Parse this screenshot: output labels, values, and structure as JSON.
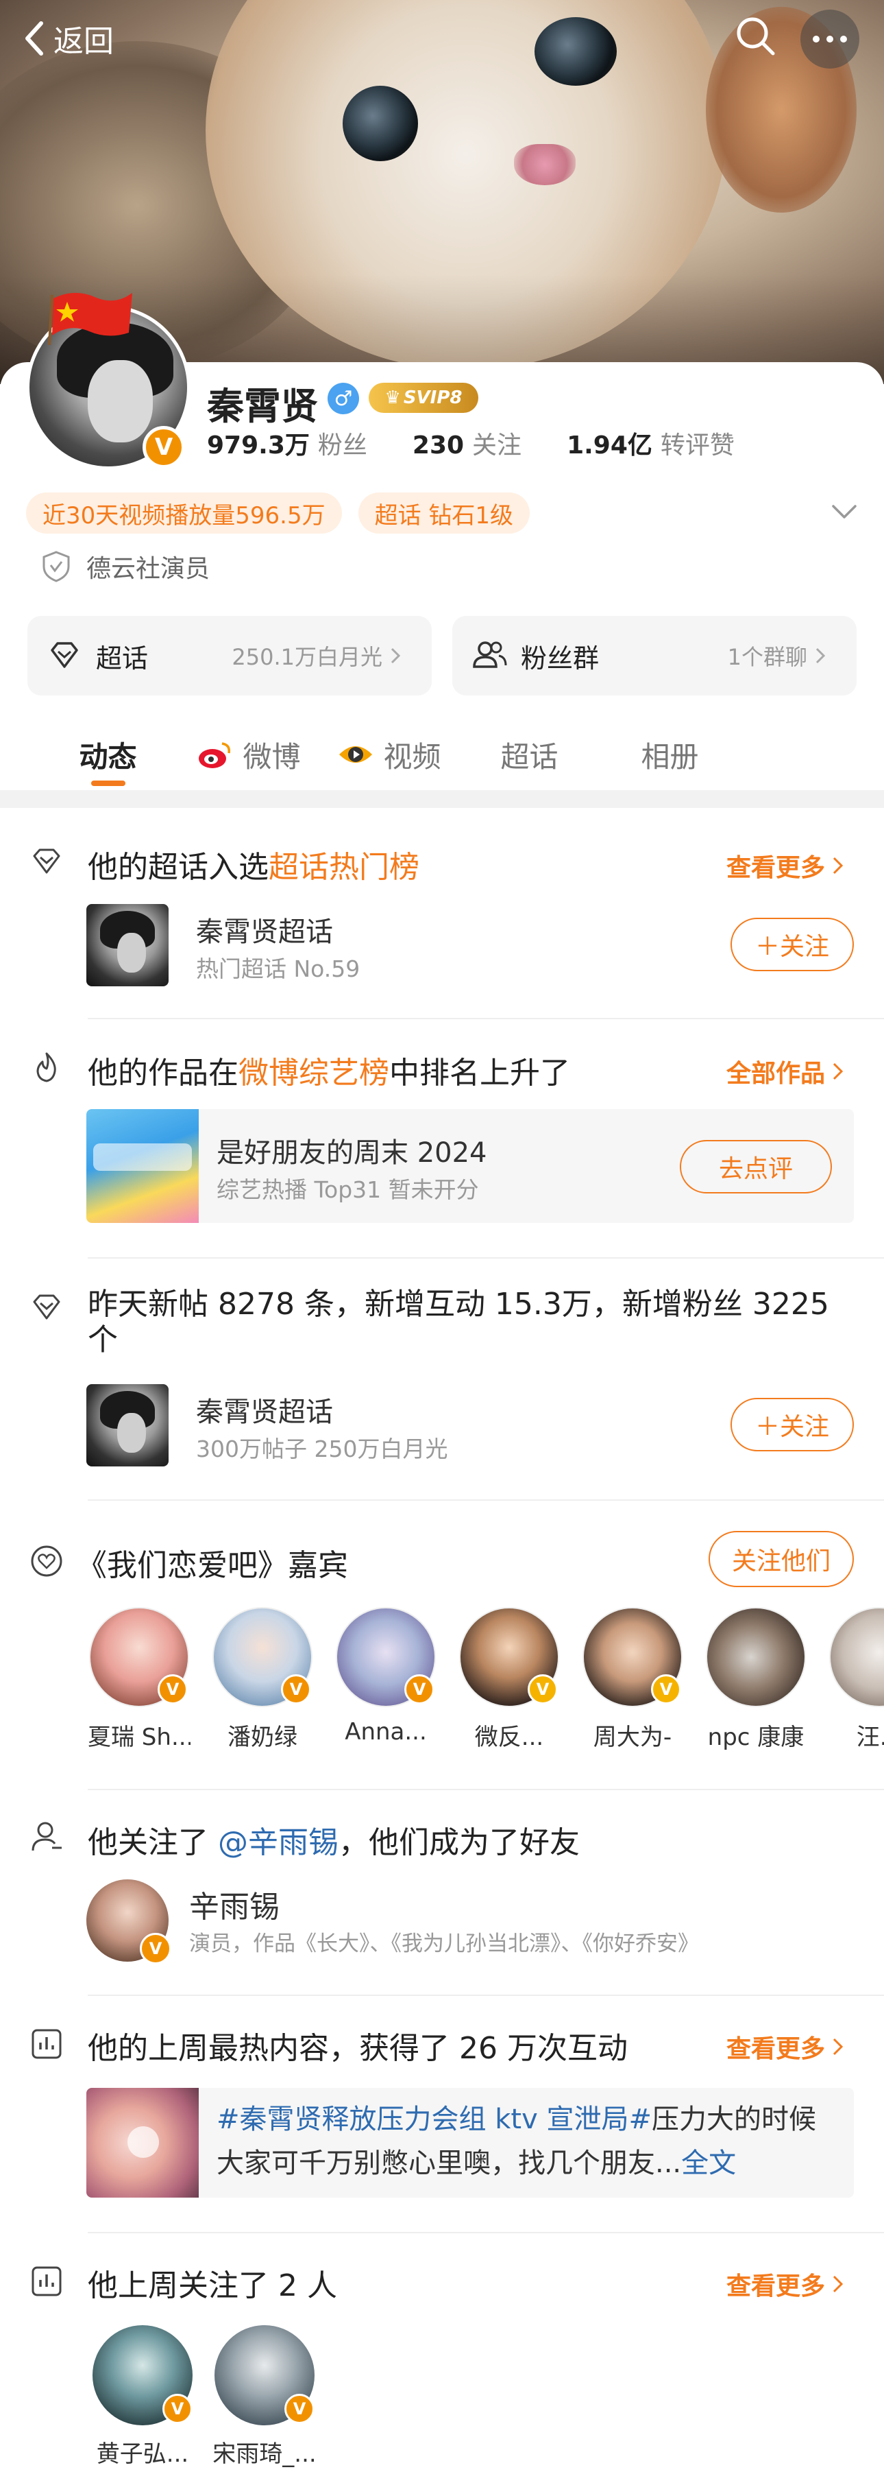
{
  "nav": {
    "back_label": "返回"
  },
  "profile": {
    "name": "秦霄贤",
    "gender_symbol": "♂",
    "svip_label": "SVIP8",
    "verified_mark": "V",
    "stats": [
      {
        "value": "979.3万",
        "label": "粉丝"
      },
      {
        "value": "230",
        "label": "关注"
      },
      {
        "value": "1.94亿",
        "label": "转评赞"
      }
    ],
    "tags": [
      "近30天视频播放量596.5万",
      "超话 钻石1级"
    ],
    "identity": "德云社演员",
    "quick_links": [
      {
        "label": "超话",
        "value": "250.1万白月光"
      },
      {
        "label": "粉丝群",
        "value": "1个群聊"
      }
    ]
  },
  "tabs": [
    {
      "label": "动态",
      "active": true
    },
    {
      "label": "微博",
      "active": false
    },
    {
      "label": "视频",
      "active": false
    },
    {
      "label": "超话",
      "active": false
    },
    {
      "label": "相册",
      "active": false
    }
  ],
  "feed": {
    "s1": {
      "title_pre": "他的超话入选",
      "title_hl": "超话热门榜",
      "more": "查看更多",
      "item_title": "秦霄贤超话",
      "item_sub": "热门超话 No.59",
      "button": "＋关注"
    },
    "s2": {
      "title_pre": "他的作品在",
      "title_hl": "微博综艺榜",
      "title_post": "中排名上升了",
      "more": "全部作品",
      "item_title": "是好朋友的周末 2024",
      "item_sub": "综艺热播 Top31 暂未开分",
      "button": "去点评"
    },
    "s3": {
      "title_line1": "昨天新帖 8278 条，新增互动 15.3万，新增粉丝 3225",
      "title_line2": "个",
      "item_title": "秦霄贤超话",
      "item_sub": "300万帖子 250万白月光",
      "button": "＋关注"
    },
    "s4": {
      "title": "《我们恋爱吧》嘉宾",
      "button": "关注他们",
      "guests": [
        "夏瑞 Sh...",
        "潘奶绿",
        "Anna...",
        "微反...",
        "周大为-",
        "npc 康康",
        "汪..."
      ]
    },
    "s5": {
      "title_pre": "他关注了 ",
      "title_link": "@辛雨锡",
      "title_post": "，他们成为了好友",
      "item_title": "辛雨锡",
      "item_sub": "演员，作品《长大》、《我为儿孙当北漂》、《你好乔安》"
    },
    "s6": {
      "title": "他的上周最热内容，获得了 26 万次互动",
      "more": "查看更多",
      "topic": "#秦霄贤释放压力会组 ktv 宣泄局#",
      "text_a": "压力大的时候",
      "text_b": "大家可千万别憋心里噢，找几个朋友...",
      "full": "全文"
    },
    "s7": {
      "title": "他上周关注了 2 人",
      "more": "查看更多",
      "users": [
        "黄子弘...",
        "宋雨琦_..."
      ]
    }
  },
  "colors": {
    "accent": "#f37b1d",
    "verified": "#f29100",
    "link": "#2e6bb0"
  }
}
